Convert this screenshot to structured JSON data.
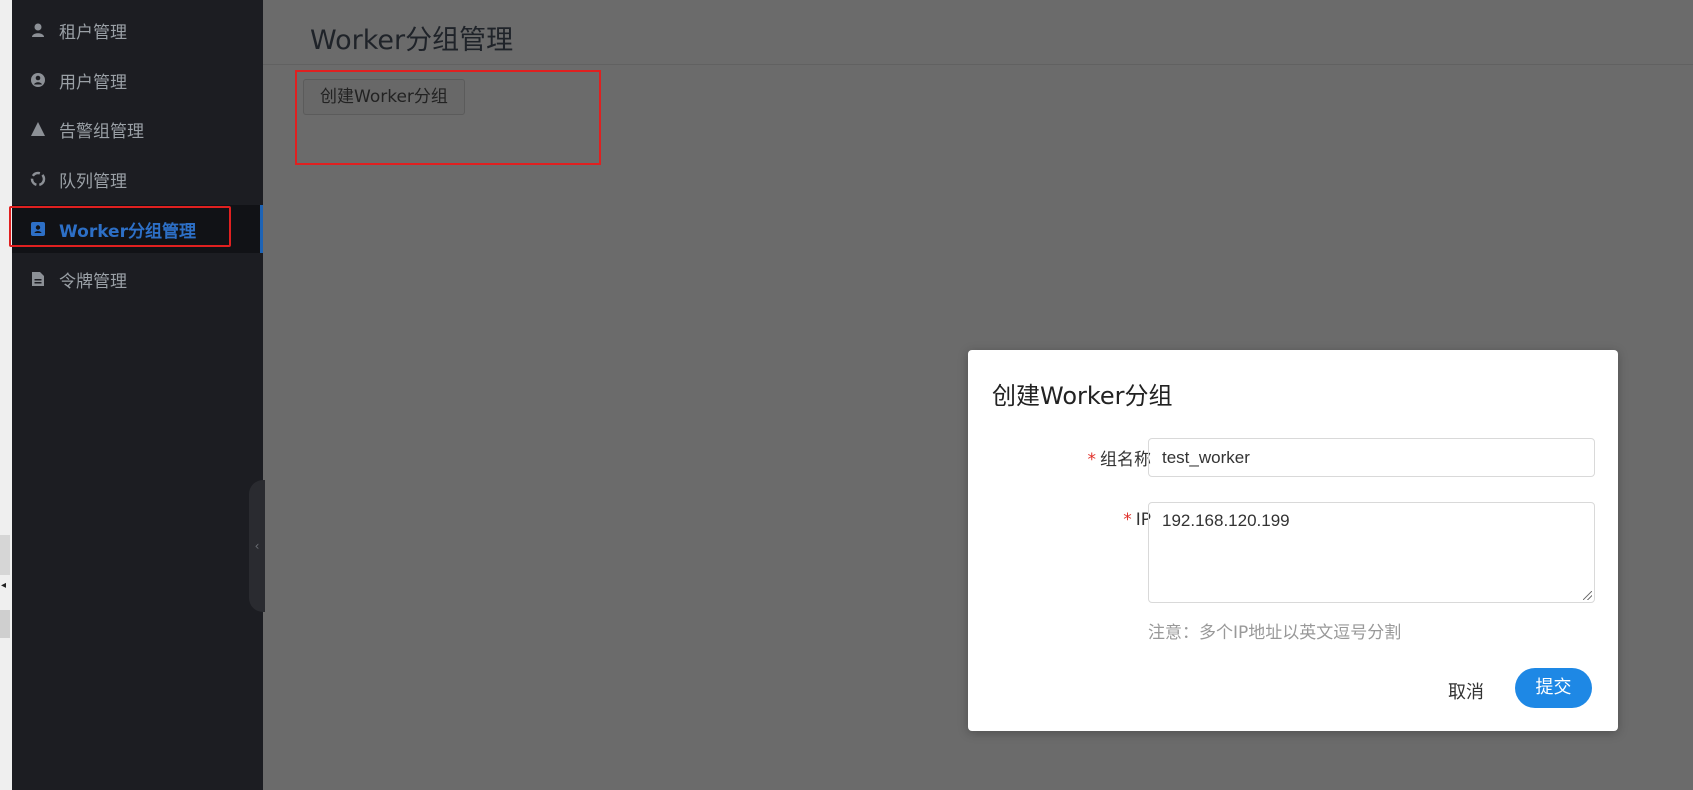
{
  "sidebar": {
    "items": [
      {
        "label": "租户管理",
        "icon": "user-icon"
      },
      {
        "label": "用户管理",
        "icon": "user-circle-icon"
      },
      {
        "label": "告警组管理",
        "icon": "warning-icon"
      },
      {
        "label": "队列管理",
        "icon": "recycle-icon"
      },
      {
        "label": "Worker分组管理",
        "icon": "id-card-icon",
        "active": true
      },
      {
        "label": "令牌管理",
        "icon": "file-icon"
      }
    ],
    "active_color": "#2d6fc6"
  },
  "page": {
    "title": "Worker分组管理",
    "create_button": "创建Worker分组"
  },
  "modal": {
    "title": "创建Worker分组",
    "fields": {
      "group_name": {
        "label": "组名称",
        "value": "test_worker"
      },
      "ip": {
        "label": "IP",
        "value": "192.168.120.199"
      }
    },
    "hint": "注意：多个IP地址以英文逗号分割",
    "cancel_label": "取消",
    "submit_label": "提交",
    "required_mark": "*"
  },
  "colors": {
    "overlay": "#6b6b6b",
    "sidebar_bg": "#1c1d22",
    "primary": "#1e88e5",
    "highlight_box": "#e02020"
  }
}
